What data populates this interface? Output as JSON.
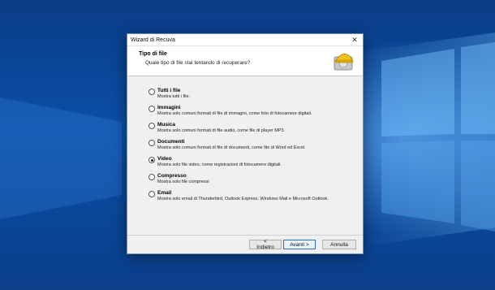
{
  "window": {
    "title": "Wizard di Recuva"
  },
  "header": {
    "title": "Tipo di file",
    "subtitle": "Quale tipo di file stai tentando di recuperare?"
  },
  "options": [
    {
      "label": "Tutti i file",
      "desc": "Mostra tutti i file.",
      "checked": false
    },
    {
      "label": "Immagini",
      "desc": "Mostra solo comuni formati di file di immagini, come foto di fotocamere digitali.",
      "checked": false
    },
    {
      "label": "Musica",
      "desc": "Mostra solo comuni formati di file audio, come file di player MP3.",
      "checked": false
    },
    {
      "label": "Documenti",
      "desc": "Mostra solo comuni formati di file di documenti, come file di Word ed Excel.",
      "checked": false
    },
    {
      "label": "Video",
      "desc": "Mostra solo file video, come registrazioni di fotocamere digitali.",
      "checked": true
    },
    {
      "label": "Compresso",
      "desc": "Mostra solo file compressi",
      "checked": false
    },
    {
      "label": "Email",
      "desc": "Mostra solo email di Thunderbird, Outlook Express, Windows Mail e Microsoft Outlook.",
      "checked": false
    }
  ],
  "buttons": {
    "back": "< Indietro",
    "next": "Avanti >",
    "cancel": "Annulla"
  },
  "colors": {
    "desktop": "#0b4fa8",
    "accent": "#2b70c9"
  },
  "icons": {
    "close": "close-icon",
    "wizard": "recuva-hardhat-drive-icon"
  }
}
